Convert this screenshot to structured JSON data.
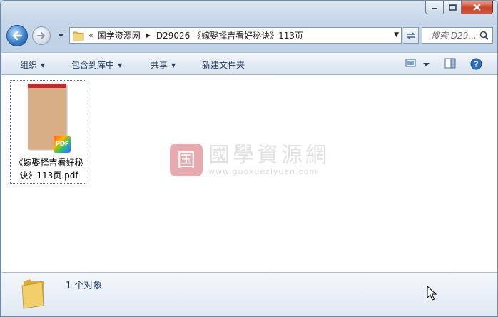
{
  "window": {
    "buttons": {
      "minimize_icon": "minimize-icon",
      "maximize_icon": "maximize-icon",
      "close_icon": "close-icon"
    }
  },
  "navigation": {
    "back_icon": "arrow-left-icon",
    "forward_icon": "arrow-right-icon",
    "history_icon": "chevron-down-icon"
  },
  "address_bar": {
    "overflow_chevron": "«",
    "breadcrumbs": [
      "国学资源网",
      "D29026 《嫁娶择吉看好秘诀》113页"
    ]
  },
  "search": {
    "placeholder": "搜索 D29..."
  },
  "toolbar": {
    "organize": "组织",
    "include_in_library": "包含到库中",
    "share": "共享",
    "new_folder": "新建文件夹"
  },
  "files": [
    {
      "name": "《嫁娶择吉看好秘诀》113页.pdf",
      "badge": "PDF"
    }
  ],
  "watermark": {
    "logo_text": "国",
    "chinese": "國學資源網",
    "url": "www.guoxueziyuan.com"
  },
  "status": {
    "item_count": "1 个对象"
  },
  "colors": {
    "accent": "#3a7fcf",
    "close": "#c7452c",
    "toolbar_text": "#1e395b"
  }
}
